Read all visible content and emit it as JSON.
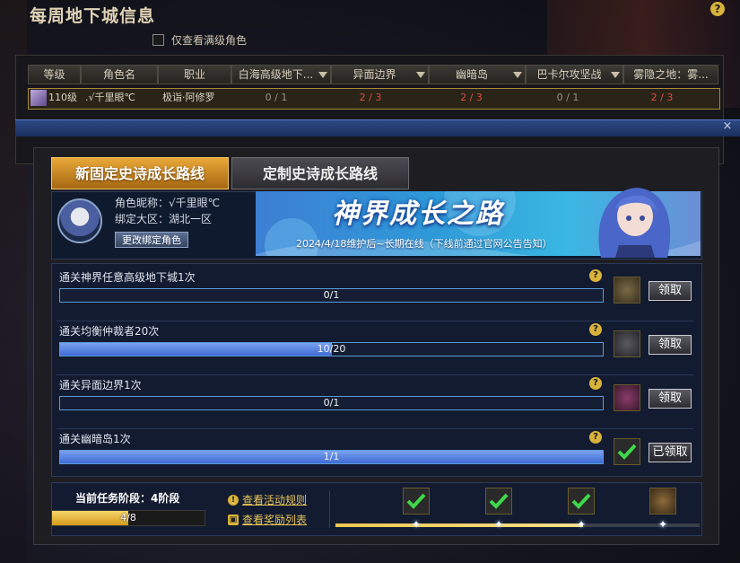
{
  "window": {
    "title": "每周地下城信息",
    "help": "?"
  },
  "filter": {
    "label": "仅查看满级角色"
  },
  "table": {
    "columns": [
      "等级",
      "角色名",
      "职业",
      "白海高级地下...",
      "异面边界",
      "幽暗岛",
      "巴卡尔攻坚战",
      "雾隐之地：雾..."
    ],
    "row": {
      "level": "110级",
      "name": ".√千里眼℃",
      "job": "极诣·阿修罗",
      "c1": "0 / 1",
      "c2": "2 / 3",
      "c3": "2 / 3",
      "c4": "0 / 1",
      "c5": "2 / 3"
    }
  },
  "dialog": {
    "close": "×",
    "tabs": [
      "新固定史诗成长路线",
      "定制史诗成长路线"
    ],
    "profile": {
      "nickname": "角色昵称：√千里眼℃",
      "zone": "绑定大区：湖北一区",
      "change_button": "更改绑定角色"
    },
    "banner": {
      "title": "神界成长之路",
      "subtitle": "2024/4/18维护后~长期在线（下线前通过官网公告告知）"
    },
    "quests": [
      {
        "label": "通关神界任意高级地下城1次",
        "value": "0/1",
        "progress": 0.0,
        "button": "领取",
        "claimed": false
      },
      {
        "label": "通关均衡仲裁者20次",
        "value": "10/20",
        "progress": 0.5,
        "button": "领取",
        "claimed": false
      },
      {
        "label": "通关异面边界1次",
        "value": "0/1",
        "progress": 0.0,
        "button": "领取",
        "claimed": false
      },
      {
        "label": "通关幽暗岛1次",
        "value": "1/1",
        "progress": 1.0,
        "button": "已领取",
        "claimed": true
      }
    ],
    "stage": {
      "label": "当前任务阶段：4阶段",
      "value": "4/8",
      "progress": 0.5
    },
    "links": {
      "rules": "查看活动规则",
      "rewards": "查看奖励列表"
    },
    "track_progress": 0.68
  }
}
